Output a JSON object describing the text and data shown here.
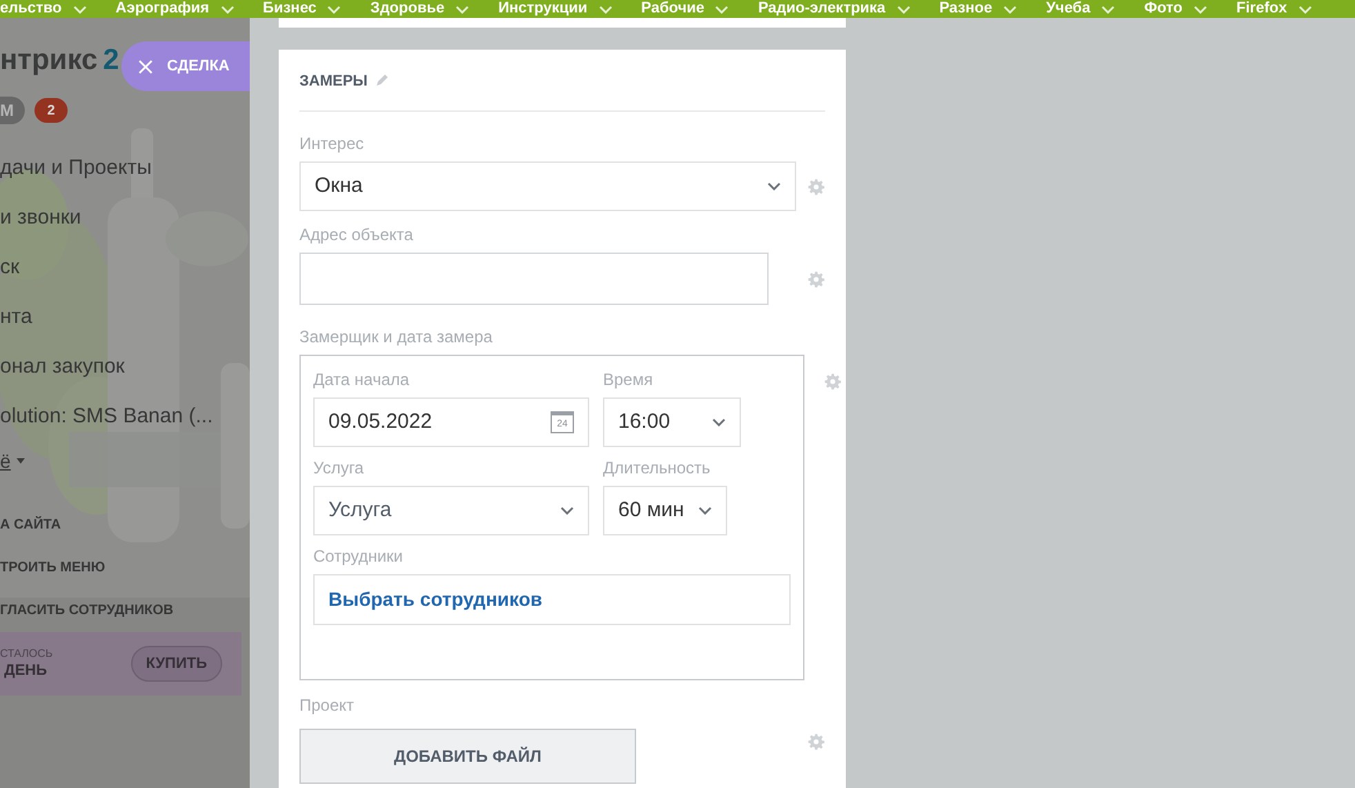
{
  "top_menu": [
    {
      "label": "ельство"
    },
    {
      "label": "Аэрография"
    },
    {
      "label": "Бизнес"
    },
    {
      "label": "Здоровье"
    },
    {
      "label": "Инструкции"
    },
    {
      "label": "Рабочие"
    },
    {
      "label": "Радио-электрика"
    },
    {
      "label": "Разное"
    },
    {
      "label": "Учеба"
    },
    {
      "label": "Фото"
    },
    {
      "label": "Firefox"
    }
  ],
  "sidebar": {
    "logo": "нтрикс",
    "logo_accent": "2",
    "badges": [
      {
        "label": "M",
        "kind": "grey"
      },
      {
        "label": "2",
        "kind": "alert"
      }
    ],
    "items": [
      {
        "label": "дачи и Проекты"
      },
      {
        "label": "и звонки"
      },
      {
        "label": "ск"
      },
      {
        "label": "нта"
      },
      {
        "label": "онал закупок"
      },
      {
        "label": "olution: SMS Banan (..."
      }
    ],
    "more": "ё",
    "links": [
      {
        "label": "А САЙТА"
      },
      {
        "label": "ТРОИТЬ МЕНЮ"
      },
      {
        "label": "ГЛАСИТЬ СОТРУДНИКОВ"
      }
    ],
    "trial": {
      "caption": "СТАЛОСЬ",
      "value": "ДЕНЬ",
      "button": "КУПИТЬ"
    }
  },
  "slider_tab": {
    "label": "СДЕЛКА"
  },
  "section": {
    "title": "ЗАМЕРЫ",
    "fields": [
      {
        "kind": "select",
        "label": "Интерес",
        "value": "Окна"
      },
      {
        "kind": "text",
        "label": "Адрес объекта"
      },
      {
        "kind": "group",
        "label": "Замерщик и дата замера",
        "date_label": "Дата начала",
        "date": "09.05.2022",
        "calendar_day": "24",
        "time_label": "Время",
        "time": "16:00",
        "service_label": "Услуга",
        "service": "Услуга",
        "duration_label": "Длительность",
        "duration": "60 мин",
        "staff_label": "Сотрудники",
        "staff_link": "Выбрать сотрудников"
      },
      {
        "kind": "file",
        "label": "Проект",
        "button": "ДОБАВИТЬ ФАЙЛ"
      }
    ]
  }
}
